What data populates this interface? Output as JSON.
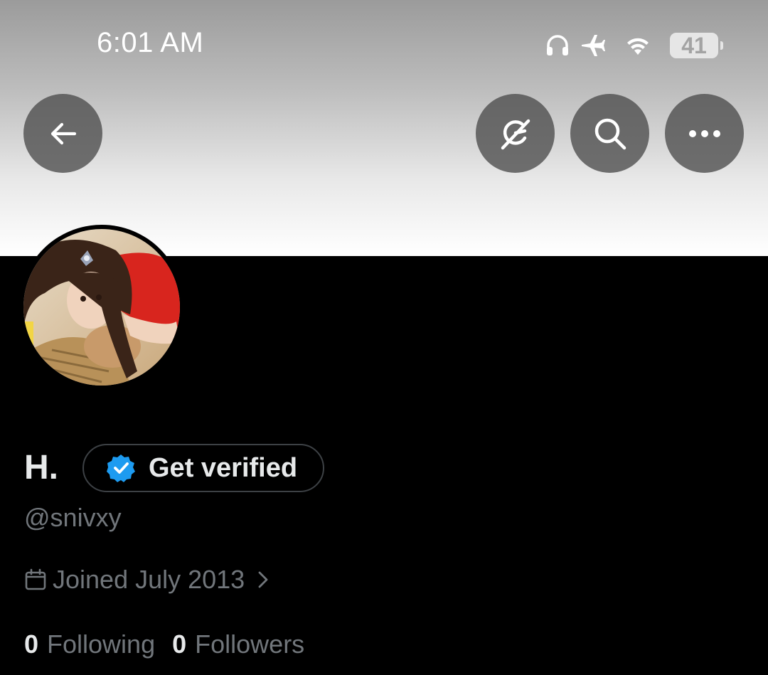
{
  "status_bar": {
    "time": "6:01 AM",
    "battery_level": "41",
    "icons": [
      "headphones-icon",
      "airplane-icon",
      "wifi-icon",
      "battery-icon"
    ]
  },
  "header": {
    "buttons": [
      "back-icon",
      "grok-icon",
      "search-icon",
      "more-icon"
    ]
  },
  "profile": {
    "display_name": "H.",
    "verify_label": "Get verified",
    "handle": "@snivxy",
    "joined": "Joined July 2013",
    "following_count": "0",
    "following_label": "Following",
    "followers_count": "0",
    "followers_label": "Followers"
  },
  "colors": {
    "background": "#000000",
    "primary_text": "#e7e9ea",
    "secondary_text": "#71767b",
    "verified_badge": "#1d9bf0",
    "pill_border": "#3d4145"
  }
}
